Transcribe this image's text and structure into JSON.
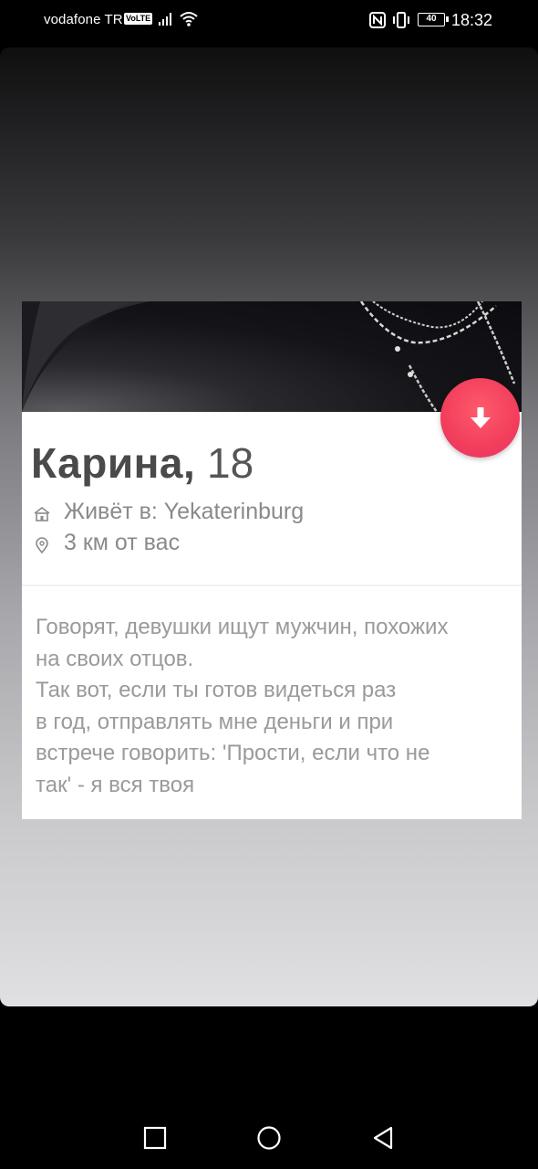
{
  "status_bar": {
    "carrier": "vodafone TR",
    "volte": "VoLTE",
    "battery": "40",
    "time": "18:32",
    "icons": [
      "signal-icon",
      "wifi-icon",
      "nfc-icon",
      "vibrate-icon",
      "battery-icon"
    ]
  },
  "profile": {
    "name": "Карина,",
    "age": "18",
    "lives_in": "Живёт в: Yekaterinburg",
    "distance": "3 км от вас",
    "bio_lines": [
      "Говорят, девушки ищут мужчин, похожих",
      "на своих отцов.",
      "Так вот, если ты готов видеться раз",
      "в год, отправлять мне деньги и при",
      "встрече говорить: 'Прости, если что не",
      "так' - я вся твоя"
    ]
  },
  "colors": {
    "accent_button": "#f23e5c",
    "name_text": "#4a4a4a",
    "secondary_text": "#8a8a8a"
  },
  "nav": {
    "icons": [
      "recent-apps-icon",
      "home-icon",
      "back-icon"
    ]
  }
}
